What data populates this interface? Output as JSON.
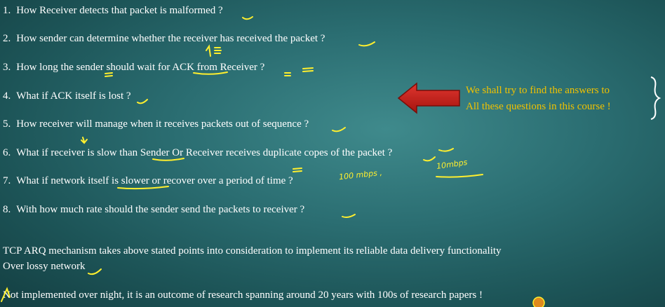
{
  "questions": [
    {
      "num": "1.",
      "text": "How Receiver detects that packet is malformed ?"
    },
    {
      "num": "2.",
      "text": "How sender can determine whether the receiver has received the packet ?"
    },
    {
      "num": "3.",
      "text": "How long the sender should wait for ACK from Receiver ?"
    },
    {
      "num": "4.",
      "text": "What if ACK itself is lost ?"
    },
    {
      "num": "5.",
      "text": "How receiver will manage when it receives packets out of sequence ?"
    },
    {
      "num": "6.",
      "text": "What if receiver is slow than Sender Or Receiver receives duplicate copes of the packet ?"
    },
    {
      "num": "7.",
      "text": "What if network itself is slower or recover over a period of time ?"
    },
    {
      "num": "8.",
      "text": "With how much rate should the sender send the packets to receiver ?"
    }
  ],
  "callout": {
    "line1": "We shall try to find the answers to",
    "line2": "All these questions in this course !"
  },
  "summary": {
    "line1": "TCP ARQ mechanism takes above stated points into consideration to implement its reliable data delivery functionality",
    "line2": "Over lossy network",
    "line3": "Not implemented over night, it is an outcome of research spanning around 20 years  with 100s of research papers !"
  },
  "handwriting": {
    "note1": "100 mbps ,",
    "note2": "10mbps"
  },
  "colors": {
    "text": "#ffffff",
    "callout": "#f2c200",
    "ink": "#ffef2e",
    "arrow": "#c8201c"
  }
}
